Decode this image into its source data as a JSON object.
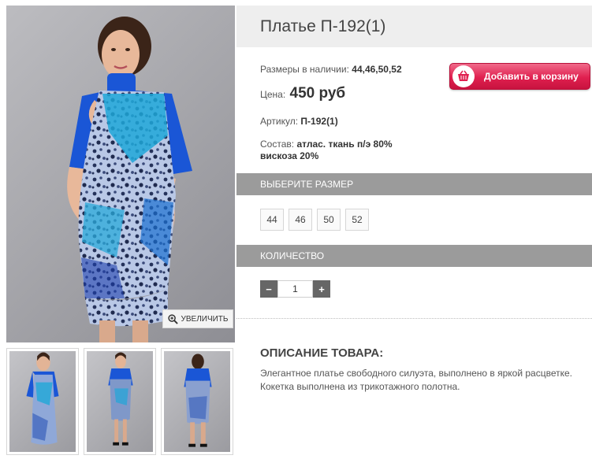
{
  "product": {
    "title": "Платье П-192(1)",
    "sizes_label": "Размеры в наличии:",
    "sizes_available": "44,46,50,52",
    "price_label": "Цена:",
    "price_value": "450 руб",
    "article_label": "Артикул:",
    "article_value": "П-192(1)",
    "composition_label": "Состав:",
    "composition_line1": "атлас. ткань п/э 80%",
    "composition_line2": "вискоза 20%"
  },
  "cart": {
    "button_label": "Добавить в корзину",
    "icon": "basket-icon",
    "color": "#e0204f"
  },
  "gallery": {
    "zoom_label": "УВЕЛИЧИТЬ",
    "thumbnail_count": 3
  },
  "size_section": {
    "header": "ВЫБЕРИТЕ РАЗМЕР",
    "options": [
      "44",
      "46",
      "50",
      "52"
    ]
  },
  "quantity_section": {
    "header": "КОЛИЧЕСТВО",
    "minus": "−",
    "value": "1",
    "plus": "+"
  },
  "description": {
    "title": "ОПИСАНИЕ ТОВАРА:",
    "text": "Элегантное платье свободного силуэта, выполнено в  яркой расцветке. Кокетка  выполнена из трикотажного полотна."
  },
  "colors": {
    "section_header_bg": "#9b9b9b",
    "title_bg": "#eeeeee",
    "dress_blue": "#1a56d6"
  }
}
